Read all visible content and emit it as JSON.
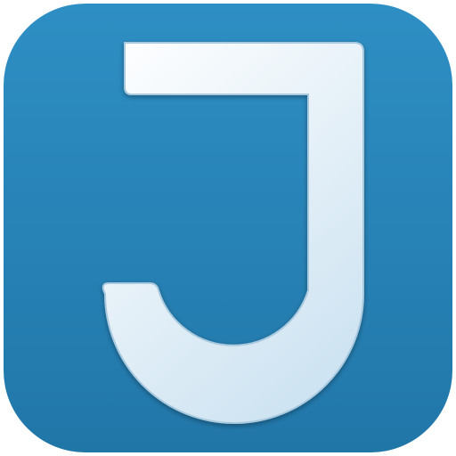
{
  "icon": {
    "name": "J",
    "colors": {
      "background_top": "#2e8fc4",
      "background_bottom": "#2176a8",
      "glyph_light": "#ffffff",
      "glyph_shade": "#cfe4f2",
      "glyph_edge": "#a9c9de"
    }
  }
}
